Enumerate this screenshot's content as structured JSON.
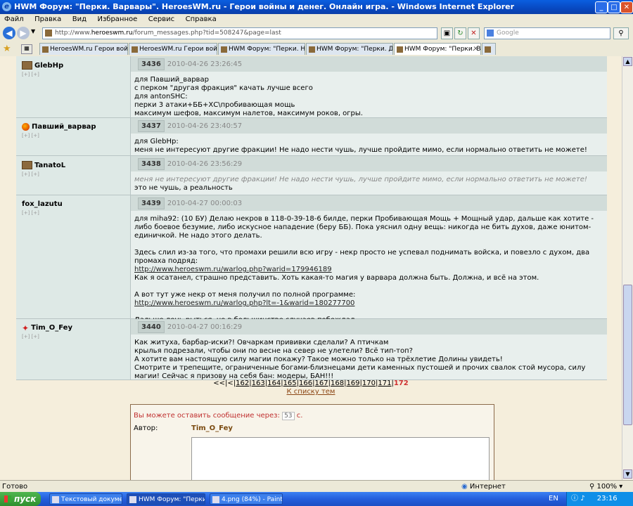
{
  "window": {
    "title": "HWM Форум: \"Перки. Варвары\". HeroesWM.ru - Герои войны и денег. Онлайн игра. - Windows Internet Explorer"
  },
  "menu": [
    "Файл",
    "Правка",
    "Вид",
    "Избранное",
    "Сервис",
    "Справка"
  ],
  "address": {
    "prefix": "http://www.",
    "domain": "heroeswm.ru",
    "path": "/forum_messages.php?tid=508247&page=last"
  },
  "search": {
    "placeholder": "Google"
  },
  "tabs": [
    {
      "label": "HeroesWM.ru Герои войны ..."
    },
    {
      "label": "HeroesWM.ru Герои войны ..."
    },
    {
      "label": "HWM Форум: \"Перки. Некро..."
    },
    {
      "label": "HWM Форум: \"Перки. Демо..."
    },
    {
      "label": "HWM Форум: \"Перки. Ва..."
    }
  ],
  "posts": [
    {
      "author": "GlebHp",
      "meta": "[+] [+]",
      "num": "3436",
      "date": "2010-04-26 23:26:45",
      "lines": [
        "для Павший_варвар",
        "с перком \"другая фракция\" качать лучше всего",
        "для antonSHC:",
        "перки 3 атаки+ББ+ХС\\пробивающая мощь",
        "максимум шефов, максимум налетов, максимум роков, огры."
      ]
    },
    {
      "author": "Павший_варвар",
      "meta": "[+] [+]",
      "num": "3437",
      "date": "2010-04-26 23:40:57",
      "lines": [
        "для GlebHp:",
        "меня не интересуют другие фракции! Не надо нести чушь, лучше пройдите мимо, если нормально ответить не можете!"
      ]
    },
    {
      "author": "TanatoL",
      "meta": "[+] [+]",
      "num": "3438",
      "date": "2010-04-26 23:56:29",
      "quote": "меня не интересуют другие фракции! Не надо нести чушь, лучше пройдите мимо, если нормально ответить не можете!",
      "lines": [
        "это не чушь, а реальность"
      ]
    },
    {
      "author": "fox_lazutu",
      "meta": "[+] [+]",
      "num": "3439",
      "date": "2010-04-27 00:00:03",
      "p1": "для miha92: (10 БУ) Делаю некров в 118-0-39-18-6 билде, перки Пробивающая Мощь + Мощный удар, дальше как хотите - либо боевое безумие, либо искусное нападение (беру ББ). Пока уяснил одну вещь: никогда не бить духов, даже юнитом-единичкой. Не надо этого делать.",
      "p2": "Здесь слил из-за того, что промахи решили всю игру - некр просто не успевал поднимать войска, и повезло с духом, два промаха подряд:",
      "link1": "http://www.heroeswm.ru/warlog.php?warid=179946189",
      "p3": "Как я осатанел, страшно представить. Хоть какая-то магия у варвара должна быть. Должна, и всё на этом.",
      "p4": "А вот тут уже некр от меня получил по полной программе:",
      "link2": "http://www.heroeswm.ru/warlog.php?lt=-1&warid=180277700",
      "p5": "Дальше лень рыться, но в большинстве случаев побеждал."
    },
    {
      "author": "Tim_O_Fey",
      "meta": "[+] [+]",
      "num": "3440",
      "date": "2010-04-27 00:16:29",
      "lines": [
        "Как житуха, барбар-иски?! Овчаркам прививки сделали? А птичкам",
        "крылья подрезали, чтобы они по весне на север не улетели? Всё тип-топ?",
        "А хотите вам настоящую силу магии покажу? Такое можно только на трёхлетие Долины увидеть!",
        "Смотрите и трепещите, ограниченные богами-близнецами дети каменных пустошей и прочих свалок стой мусора, силу магии! Сейчас я призову на себя бан: модеры, БАН!!!"
      ]
    }
  ],
  "pager": {
    "prefix": "<<|<|",
    "pages": [
      "162",
      "163",
      "164",
      "165",
      "166",
      "167",
      "168",
      "169",
      "170",
      "171"
    ],
    "current": "172",
    "to_list": "К списку тем"
  },
  "reply": {
    "wait_text": "Вы можете оставить сообщение через:",
    "counter": "53",
    "unit": "с.",
    "author_label": "Автор:",
    "author_value": "Tim_O_Fey"
  },
  "status": {
    "left": "Готово",
    "zone": "Интернет",
    "zoom": "100%"
  },
  "taskbar": {
    "start": "пуск",
    "tasks": [
      "Текстовый докумен...",
      "HWM Форум: \"Перки...",
      "4.png (84%) - Paint...."
    ],
    "lang": "EN",
    "time": "23:16"
  }
}
